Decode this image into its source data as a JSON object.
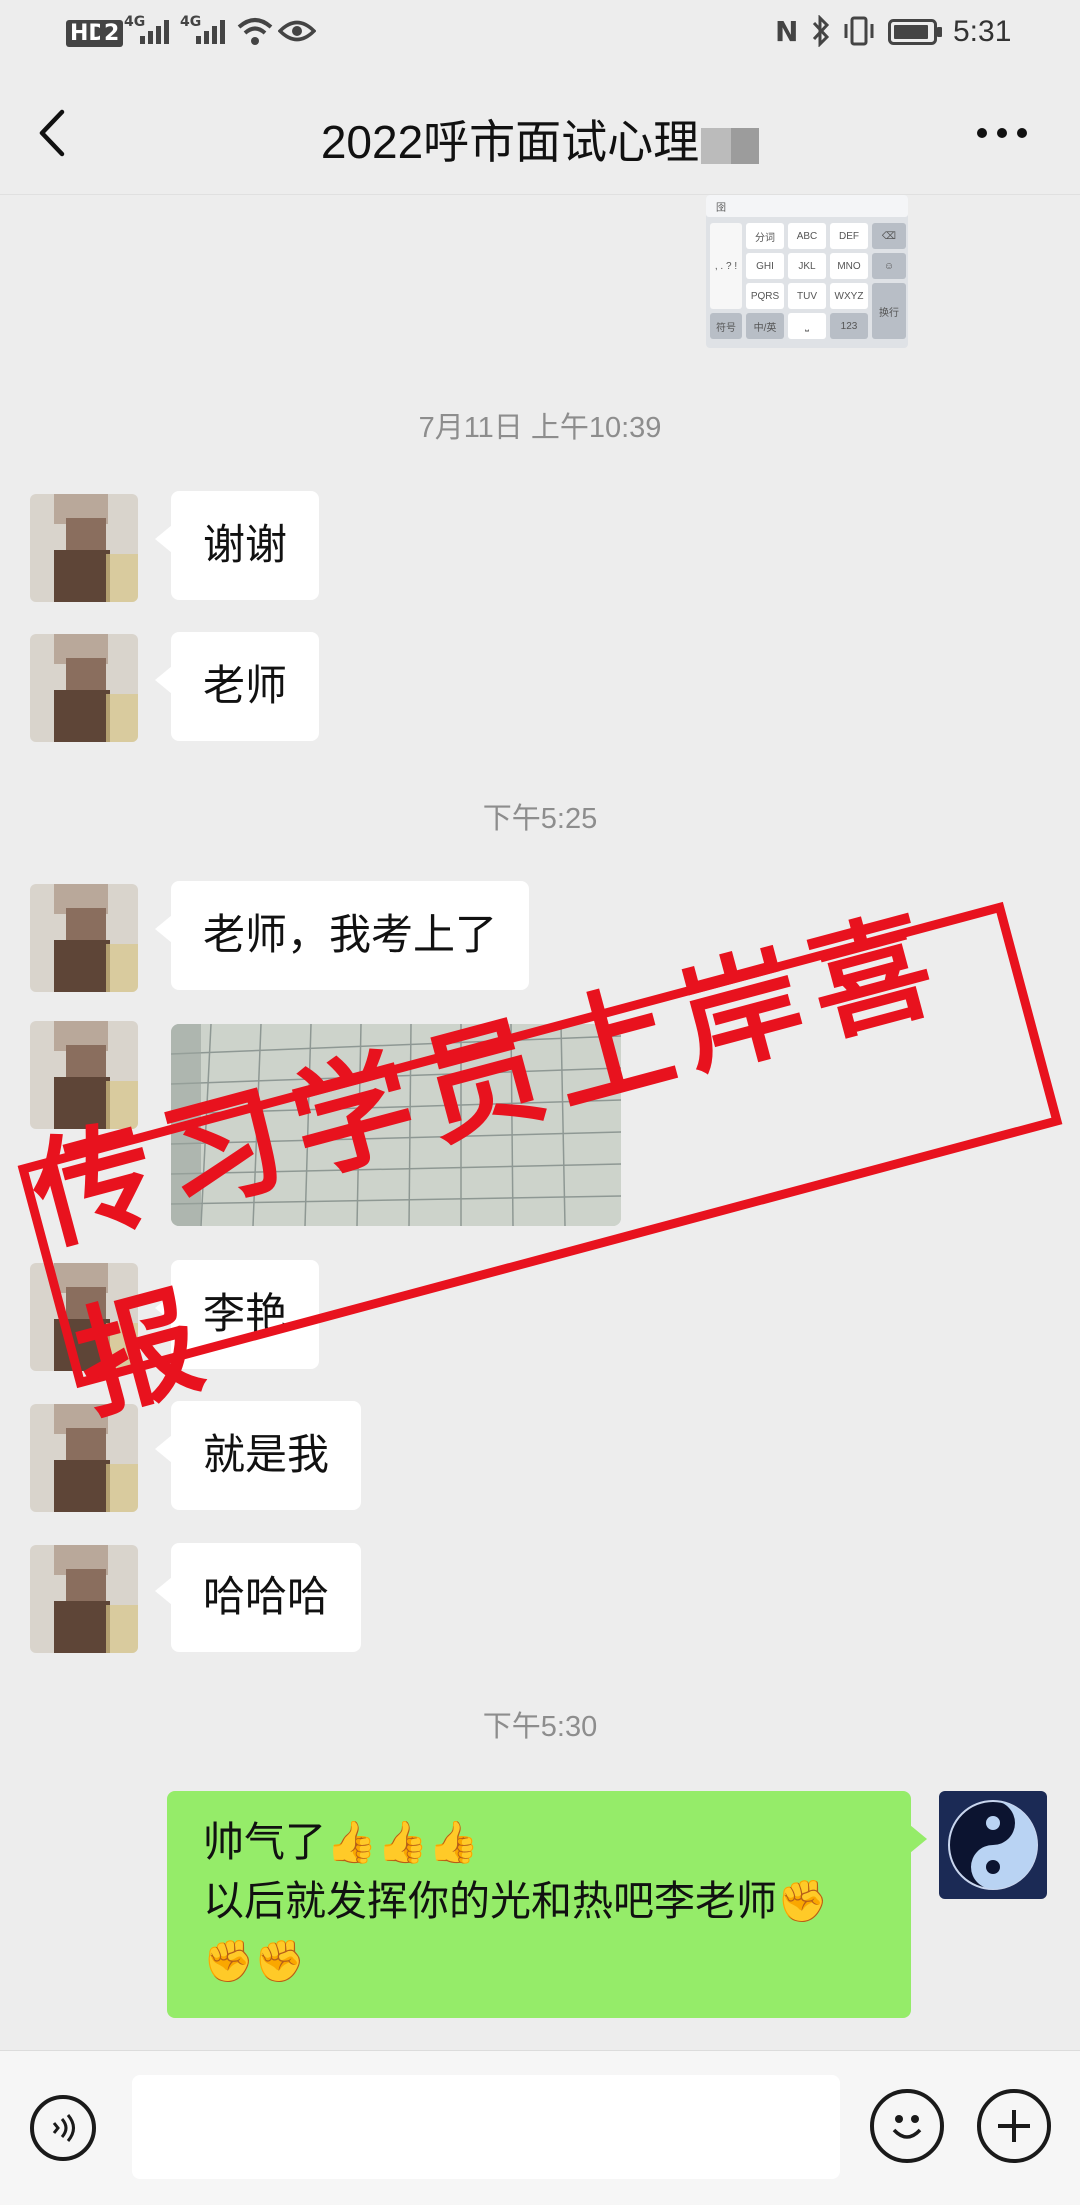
{
  "status_bar": {
    "hd": "HD",
    "sim_number": "2",
    "net1": "4G",
    "net2": "4G",
    "time": "5:31"
  },
  "header": {
    "title": "2022呼市面试心理"
  },
  "keyboard_thumbnail": {
    "keys": [
      "分词",
      "ABC",
      "DEF",
      "GHI",
      "JKL",
      "MNO",
      "PQRS",
      "TUV",
      "WXYZ",
      "符号",
      "中/英",
      "123",
      "换行"
    ]
  },
  "messages": [
    {
      "type": "time",
      "text": "7月11日 上午10:39"
    },
    {
      "type": "left",
      "text": "谢谢"
    },
    {
      "type": "left",
      "text": "老师"
    },
    {
      "type": "time",
      "text": "下午5:25"
    },
    {
      "type": "left",
      "text": "老师，我考上了"
    },
    {
      "type": "left-image"
    },
    {
      "type": "left",
      "text": "李艳"
    },
    {
      "type": "left",
      "text": "就是我"
    },
    {
      "type": "left",
      "text": "哈哈哈"
    },
    {
      "type": "time",
      "text": "下午5:30"
    },
    {
      "type": "right",
      "line1": "帅气了👍👍👍",
      "line2": "以后就发挥你的光和热吧李老师✊",
      "line3": "✊✊"
    }
  ],
  "stamp": {
    "text": "传习学员上岸喜报",
    "color": "#e8121e"
  },
  "colors": {
    "background": "#ededed",
    "sent_bubble": "#95ec69",
    "received_bubble": "#ffffff"
  },
  "icons": [
    "back-arrow-icon",
    "more-icon",
    "voice-icon",
    "emoji-icon",
    "plus-icon"
  ]
}
